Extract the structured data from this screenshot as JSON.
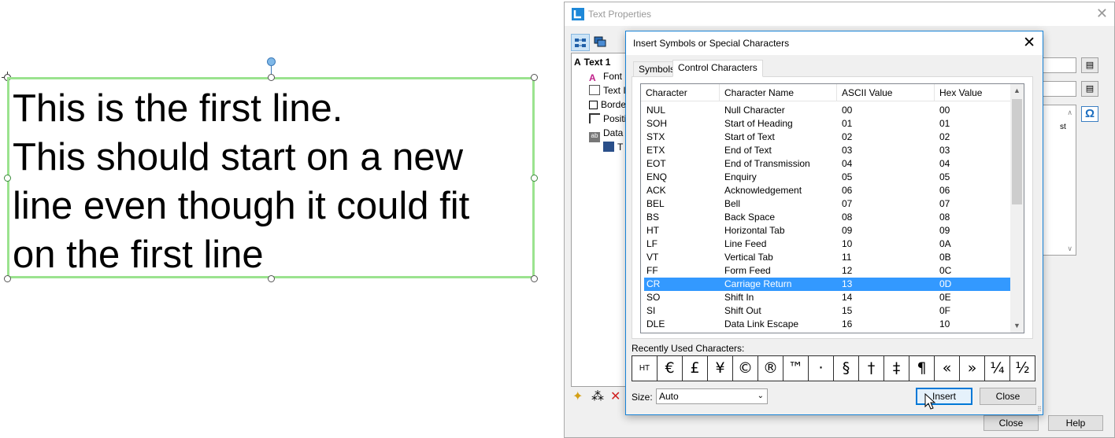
{
  "canvas": {
    "text_lines": [
      "This is the first line.",
      "This should start on a new",
      "line even though it could fit",
      "on the first line"
    ]
  },
  "text_properties": {
    "title": "Text Properties",
    "tree": {
      "root": "Text 1",
      "items": [
        "Font",
        "Text I",
        "Borde",
        "Positi",
        "Data",
        "T"
      ]
    },
    "partial_text": "st",
    "buttons": {
      "close": "Close",
      "help": "Help"
    }
  },
  "symbols_dialog": {
    "title": "Insert Symbols or Special Characters",
    "tabs": [
      "Symbols",
      "Control Characters"
    ],
    "selected_tab": "Control Characters",
    "columns": [
      "Character",
      "Character Name",
      "ASCII Value",
      "Hex Value"
    ],
    "rows": [
      [
        "NUL",
        "Null Character",
        "00",
        "00"
      ],
      [
        "SOH",
        "Start of Heading",
        "01",
        "01"
      ],
      [
        "STX",
        "Start of Text",
        "02",
        "02"
      ],
      [
        "ETX",
        "End of Text",
        "03",
        "03"
      ],
      [
        "EOT",
        "End of Transmission",
        "04",
        "04"
      ],
      [
        "ENQ",
        "Enquiry",
        "05",
        "05"
      ],
      [
        "ACK",
        "Acknowledgement",
        "06",
        "06"
      ],
      [
        "BEL",
        "Bell",
        "07",
        "07"
      ],
      [
        "BS",
        "Back Space",
        "08",
        "08"
      ],
      [
        "HT",
        "Horizontal Tab",
        "09",
        "09"
      ],
      [
        "LF",
        "Line Feed",
        "10",
        "0A"
      ],
      [
        "VT",
        "Vertical Tab",
        "11",
        "0B"
      ],
      [
        "FF",
        "Form Feed",
        "12",
        "0C"
      ],
      [
        "CR",
        "Carriage Return",
        "13",
        "0D"
      ],
      [
        "SO",
        "Shift In",
        "14",
        "0E"
      ],
      [
        "SI",
        "Shift Out",
        "15",
        "0F"
      ],
      [
        "DLE",
        "Data Link Escape",
        "16",
        "10"
      ]
    ],
    "selected_row": "CR",
    "recent_label": "Recently Used Characters:",
    "recent_chars": [
      "HT",
      "€",
      "£",
      "¥",
      "©",
      "®",
      "™",
      "·",
      "§",
      "†",
      "‡",
      "¶",
      "«",
      "»",
      "¼",
      "½"
    ],
    "size_label": "Size:",
    "size_value": "Auto",
    "insert_label": "Insert",
    "close_label": "Close"
  },
  "colors": {
    "selection": "#3399ff",
    "text_frame": "#9be38f",
    "dialog_border": "#1883d7"
  }
}
